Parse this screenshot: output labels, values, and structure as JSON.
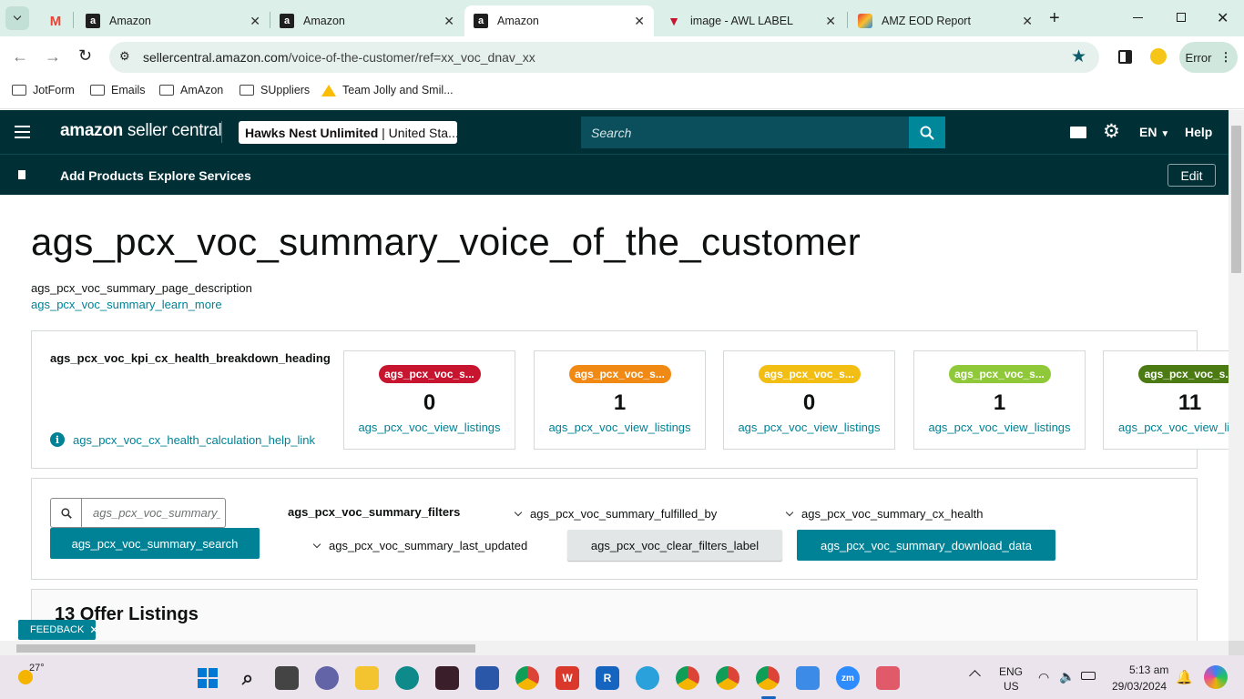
{
  "browser": {
    "tabs": [
      {
        "label": "",
        "icon": "gmail-icon"
      },
      {
        "label": "Amazon",
        "icon": "amazon-icon"
      },
      {
        "label": "Amazon",
        "icon": "amazon-icon"
      },
      {
        "label": "Amazon",
        "icon": "amazon-icon"
      },
      {
        "label": "image - AWL LABEL",
        "icon": "awl-icon"
      },
      {
        "label": "AMZ EOD Report",
        "icon": "sheets-icon"
      }
    ],
    "url_host": "sellercentral.amazon.com",
    "url_path": "/voice-of-the-customer/ref=xx_voc_dnav_xx",
    "profile_label": "Error",
    "bookmarks": [
      "JotForm",
      "Emails",
      "AmAzon",
      "SUppliers",
      "Team Jolly and Smil..."
    ]
  },
  "seller": {
    "logo_bold": "amazon",
    "logo_rest": " seller central",
    "store": "Hawks Nest Unlimited",
    "store_region": " | United Sta...",
    "search_placeholder": "Search",
    "lang": "EN",
    "help": "Help",
    "nav": [
      "Add Products",
      "Explore Services"
    ],
    "edit": "Edit"
  },
  "page": {
    "title": "ags_pcx_voc_summary_voice_of_the_customer",
    "description": "ags_pcx_voc_summary_page_description",
    "learn_more": "ags_pcx_voc_summary_learn_more",
    "kpi_heading": "ags_pcx_voc_kpi_cx_health_breakdown_heading",
    "kpi_help": "ags_pcx_voc_cx_health_calculation_help_link",
    "cards": [
      {
        "badge": "ags_pcx_voc_s...",
        "count": "0",
        "link": "ags_pcx_voc_view_listings",
        "color": "#c7152f"
      },
      {
        "badge": "ags_pcx_voc_s...",
        "count": "1",
        "link": "ags_pcx_voc_view_listings",
        "color": "#f08a14"
      },
      {
        "badge": "ags_pcx_voc_s...",
        "count": "0",
        "link": "ags_pcx_voc_view_listings",
        "color": "#f2be14"
      },
      {
        "badge": "ags_pcx_voc_s...",
        "count": "1",
        "link": "ags_pcx_voc_view_listings",
        "color": "#8fc93a"
      },
      {
        "badge": "ags_pcx_voc_s...",
        "count": "11",
        "link": "ags_pcx_voc_view_li",
        "color": "#4b7b12"
      }
    ],
    "search_placeholder": "ags_pcx_voc_summary_",
    "search_button": "ags_pcx_voc_summary_search",
    "filters_label": "ags_pcx_voc_summary_filters",
    "filter_fulfilled": "ags_pcx_voc_summary_fulfilled_by",
    "filter_health": "ags_pcx_voc_summary_cx_health",
    "filter_updated": "ags_pcx_voc_summary_last_updated",
    "clear_filters": "ags_pcx_voc_clear_filters_label",
    "download": "ags_pcx_voc_summary_download_data",
    "listings_title": "13 Offer Listings",
    "feedback": "FEEDBACK"
  },
  "taskbar": {
    "weather": "27°",
    "lang_line1": "ENG",
    "lang_line2": "US",
    "time": "5:13 am",
    "date": "29/03/2024"
  }
}
